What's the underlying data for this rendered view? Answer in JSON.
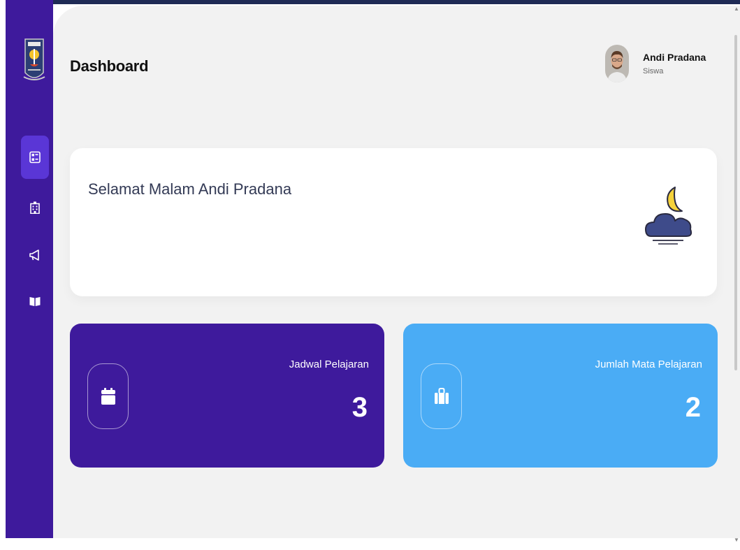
{
  "header": {
    "title": "Dashboard"
  },
  "user": {
    "name": "Andi Pradana",
    "role": "Siswa"
  },
  "greeting": {
    "text": "Selamat Malam Andi Pradana",
    "icon": "moon-cloud-icon"
  },
  "sidebar": {
    "items": [
      {
        "icon": "dashboard-icon",
        "active": true
      },
      {
        "icon": "building-icon",
        "active": false
      },
      {
        "icon": "megaphone-icon",
        "active": false
      },
      {
        "icon": "book-icon",
        "active": false
      }
    ]
  },
  "stats": [
    {
      "label": "Jadwal Pelajaran",
      "value": "3",
      "icon": "calendar-icon",
      "color": "#3e1a9c"
    },
    {
      "label": "Jumlah Mata Pelajaran",
      "value": "2",
      "icon": "briefcase-icon",
      "color": "#4aacf5"
    }
  ],
  "colors": {
    "sidebar": "#3e1a9c",
    "accent_blue": "#4aacf5",
    "background": "#f2f2f2"
  }
}
